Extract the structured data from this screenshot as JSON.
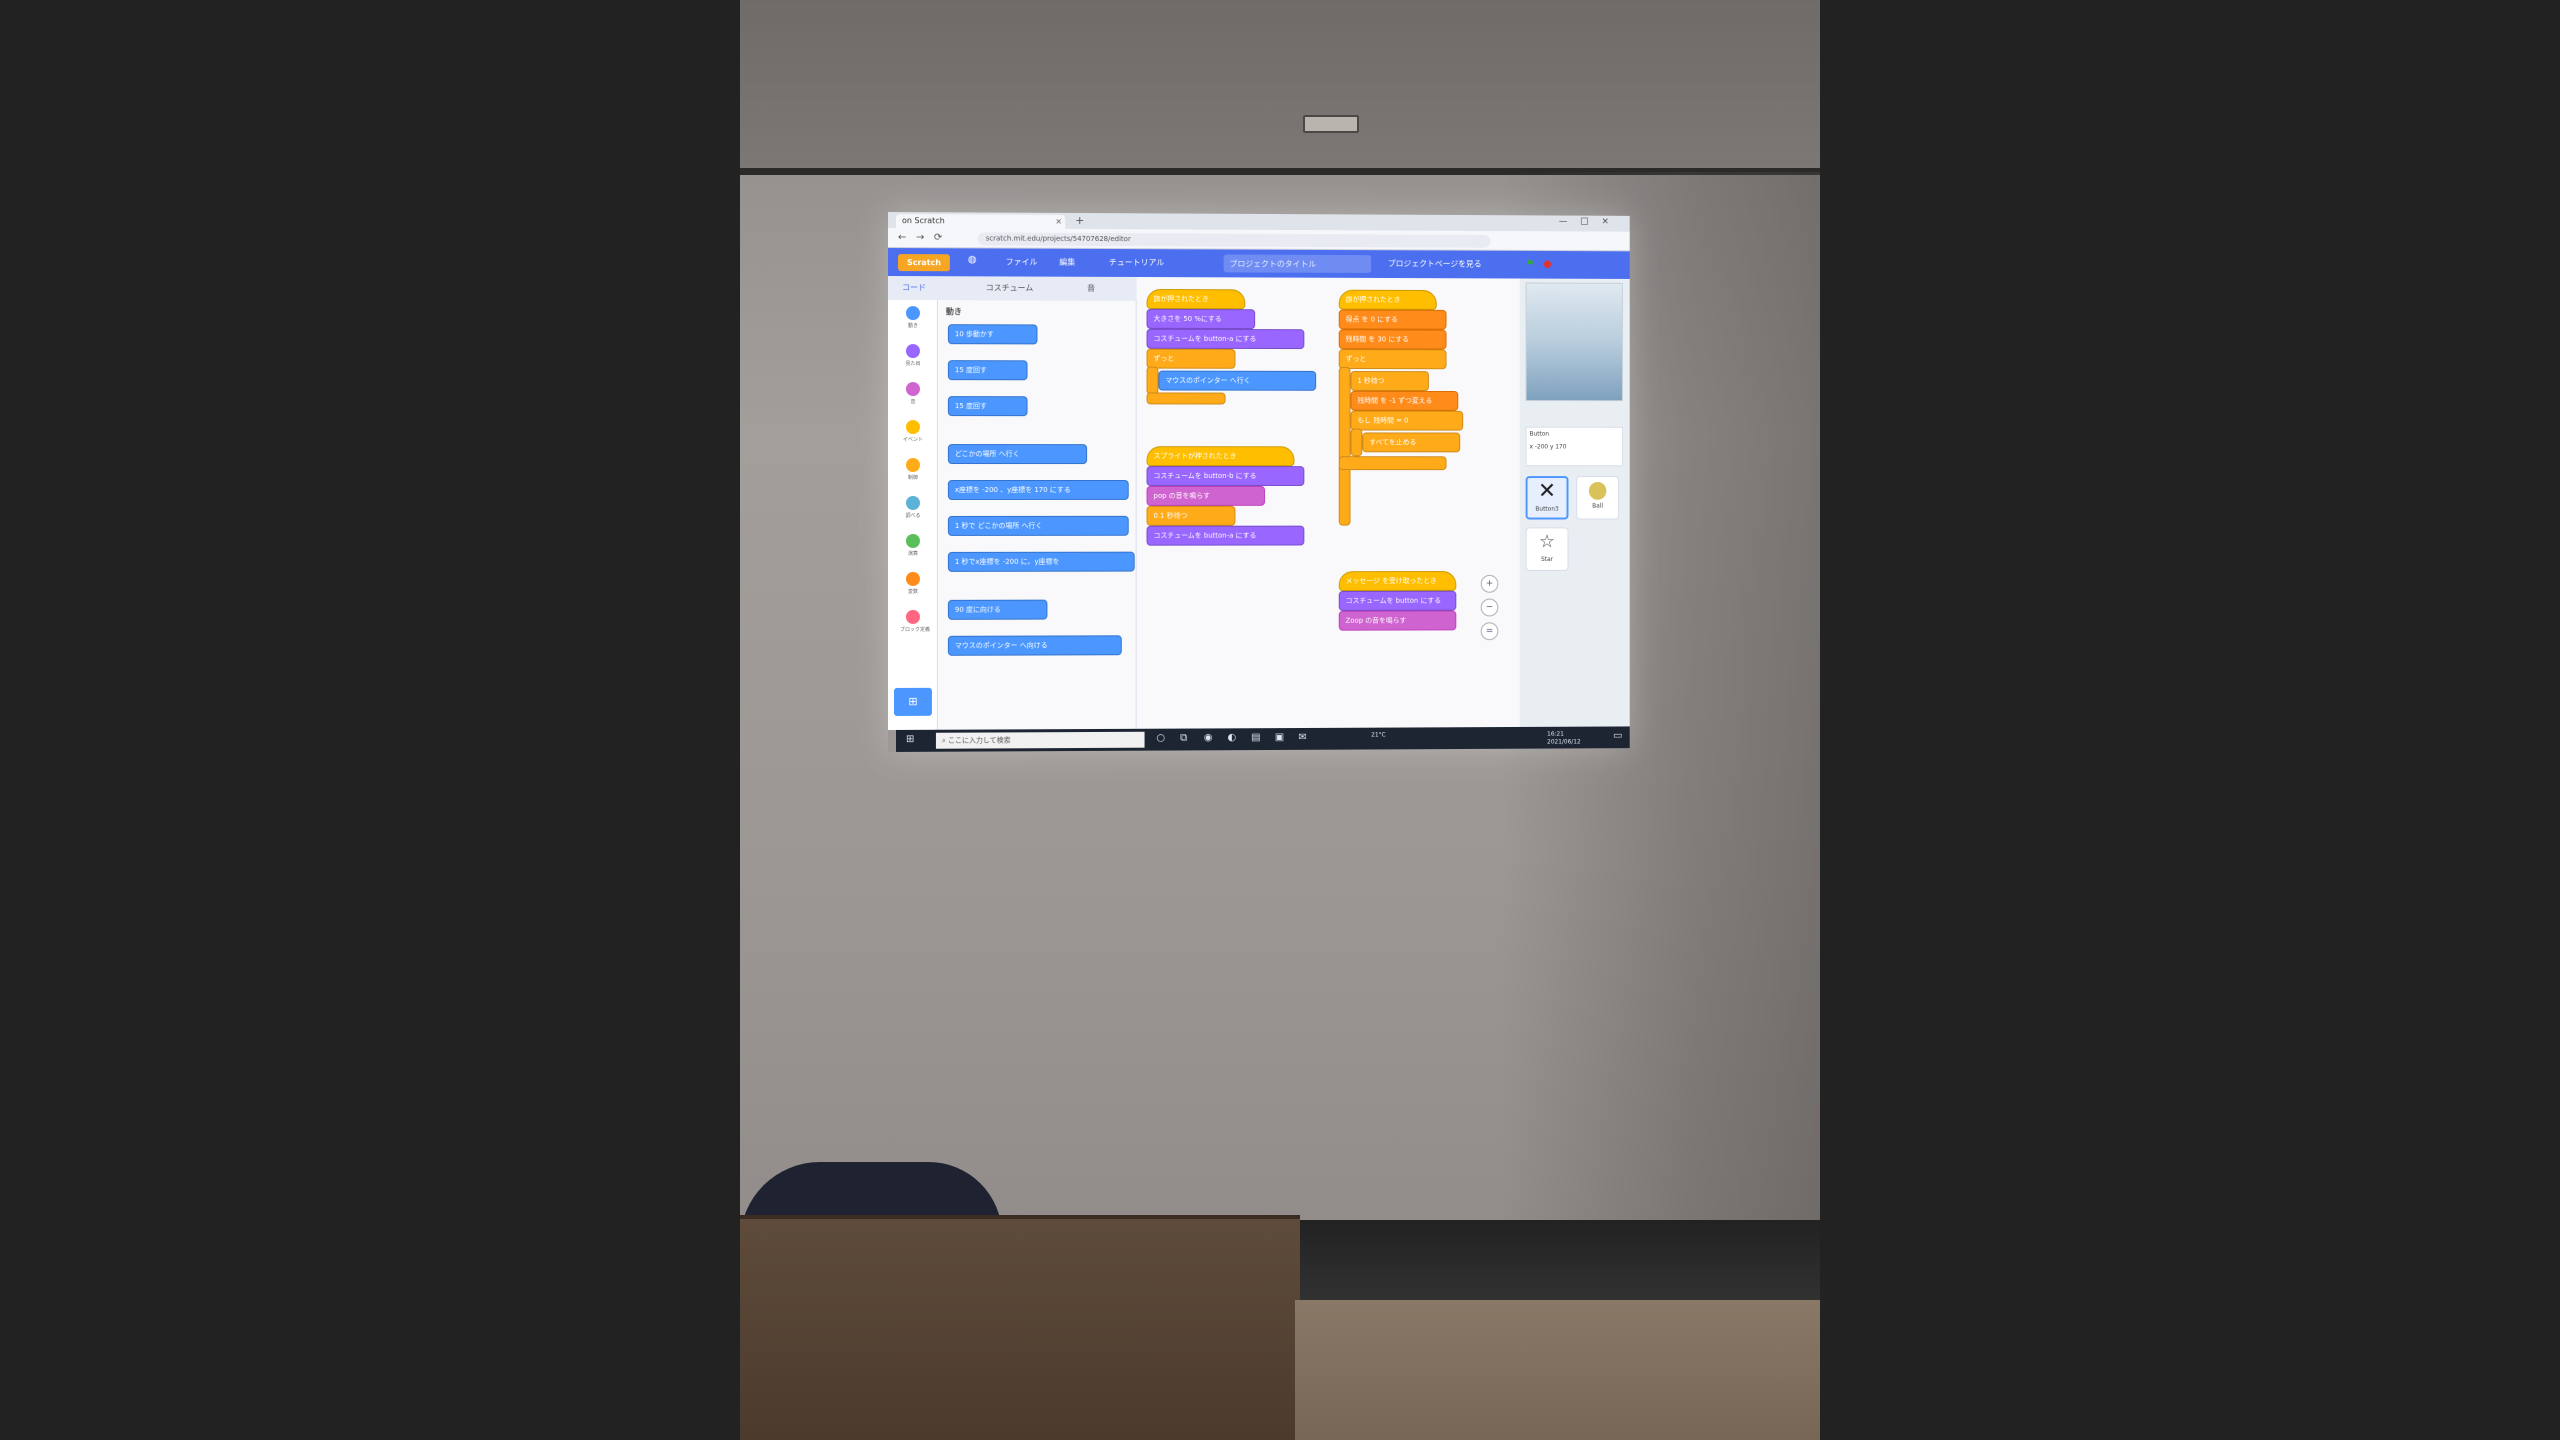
{
  "browser": {
    "tab_title": "on Scratch",
    "tab_close": "×",
    "new_tab": "+",
    "window_controls": [
      "—",
      "□",
      "×"
    ],
    "url": "scratch.mit.edu/projects/54707628/editor",
    "nav": [
      "←",
      "→",
      "⟳"
    ]
  },
  "menubar": {
    "logo": "Scratch",
    "globe_icon": "globe-icon",
    "file": "ファイル",
    "edit": "編集",
    "tutorial": "チュートリアル",
    "project_title": "プロジェクトのタイトル",
    "see_project_page": "プロジェクトページを見る"
  },
  "subtabs": {
    "code": "コード",
    "costumes": "コスチューム",
    "sounds": "音"
  },
  "categories": [
    {
      "label": "動き",
      "color": "#4c97ff"
    },
    {
      "label": "見た目",
      "color": "#9966ff"
    },
    {
      "label": "音",
      "color": "#cf63cf"
    },
    {
      "label": "イベント",
      "color": "#ffbf00"
    },
    {
      "label": "制御",
      "color": "#ffab19"
    },
    {
      "label": "調べる",
      "color": "#5cb1d6"
    },
    {
      "label": "演算",
      "color": "#59c059"
    },
    {
      "label": "変数",
      "color": "#ff8c1a"
    },
    {
      "label": "ブロック定義",
      "color": "#ff6680"
    }
  ],
  "palette": {
    "title": "動き",
    "blocks": [
      "10 歩動かす",
      "15 度回す",
      "15 度回す",
      "どこかの場所 へ行く",
      "x座標を -200 、y座標を 170 にする",
      "1 秒で どこかの場所 へ行く",
      "1 秒でx座標を -200 に、y座標を",
      "90 度に向ける",
      "マウスのポインター へ向ける"
    ]
  },
  "scripts": {
    "s1_hat": "旗が押されたとき",
    "s1_b1": "大きさを 50 %にする",
    "s1_b2": "コスチュームを button-a にする",
    "s1_forever": "ずっと",
    "s1_b3": "マウスのポインター へ行く",
    "s2_hat": "スプライトが押されたとき",
    "s2_b1": "コスチュームを button-b にする",
    "s2_b2": "pop の音を鳴らす",
    "s2_b3": "0.1 秒待つ",
    "s2_b4": "コスチュームを button-a にする",
    "s3_hat": "旗が押されたとき",
    "s3_b1": "得点 を 0 にする",
    "s3_b2": "残時間 を 30 にする",
    "s3_forever": "ずっと",
    "s3_b4": "1 秒待つ",
    "s3_b5": "残時間 を -1 ずつ変える",
    "s3_if": "もし 残時間 = 0",
    "s3_b6": "すべてを止める",
    "s4_hat": "メッセージ を受け取ったとき",
    "s4_b1": "コスチュームを button にする",
    "s4_b2": "Zoop の音を鳴らす"
  },
  "stage_panel": {
    "sprite_name": "Button",
    "x_value": "-200",
    "y_value": "170",
    "sprites": [
      {
        "name": "Button3",
        "icon": "close-x-icon"
      },
      {
        "name": "Ball",
        "icon": "ball-icon"
      },
      {
        "name": "Star",
        "icon": "star-icon"
      }
    ]
  },
  "taskbar": {
    "search_placeholder": "ここに入力して検索",
    "temperature": "21°C",
    "time": "16:21",
    "date": "2021/06/12"
  }
}
